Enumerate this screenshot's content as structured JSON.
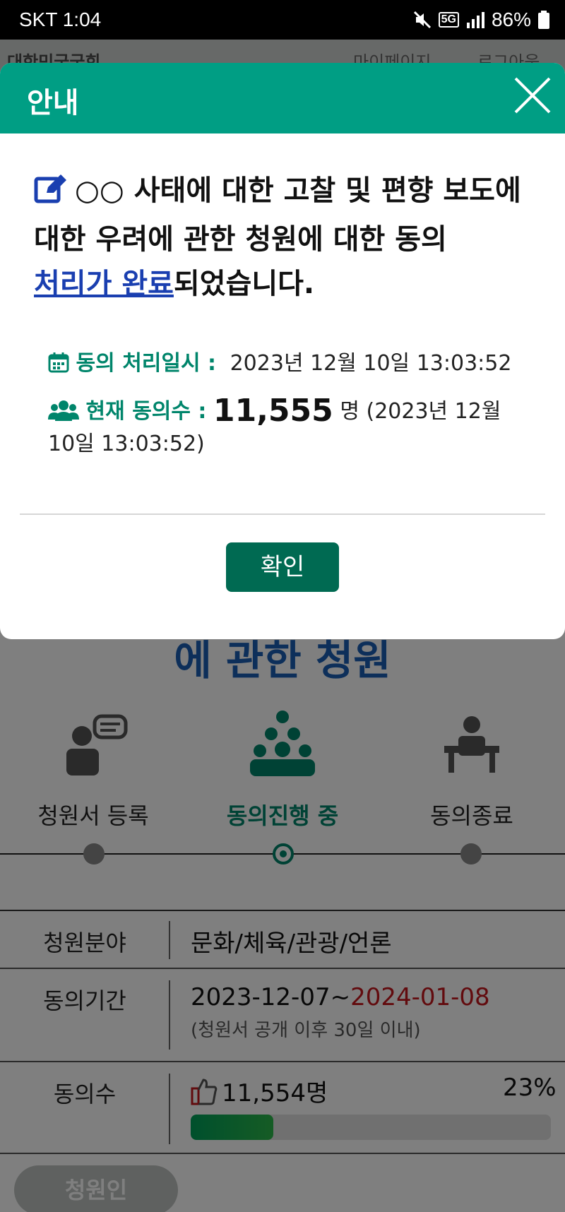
{
  "status_bar": {
    "time": "SKT 1:04",
    "battery": "86%",
    "network": "5G"
  },
  "header": {
    "site_name": "대한민국국회",
    "nav": [
      "마이페이지",
      "로그아웃"
    ]
  },
  "background": {
    "title": "에 관한 청원",
    "steps": [
      {
        "label": "청원서 등록",
        "active": false
      },
      {
        "label": "동의진행 중",
        "active": true
      },
      {
        "label": "동의종료",
        "active": false
      }
    ],
    "table": {
      "field": {
        "label": "청원분야",
        "value": "문화/체육/관광/언론"
      },
      "period": {
        "label": "동의기간",
        "start": "2023-12-07~",
        "end": "2024-01-08",
        "note": "(청원서 공개 이후 30일 이내)"
      },
      "count": {
        "label": "동의수",
        "value": "11,554명",
        "percent": "23%",
        "progress": 0.23
      }
    },
    "petitioner_button": "청원인"
  },
  "modal": {
    "title": "안내",
    "message_main": "○○ 사태에 대한 고찰 및 편향 보도에 대한 우려에 관한 청원에 대한 동의",
    "message_link": "처리가 완료",
    "message_tail": "되었습니다.",
    "processed_label": "동의 처리일시 :",
    "processed_value": "2023년 12월 10일 13:03:52",
    "count_label": "현재 동의수 :",
    "count_value": "11,555",
    "count_unit": "명",
    "count_time": "(2023년 12월 10일 13:03:52)",
    "confirm_label": "확인",
    "accent_color": "#009e84",
    "button_color": "#006a52"
  }
}
